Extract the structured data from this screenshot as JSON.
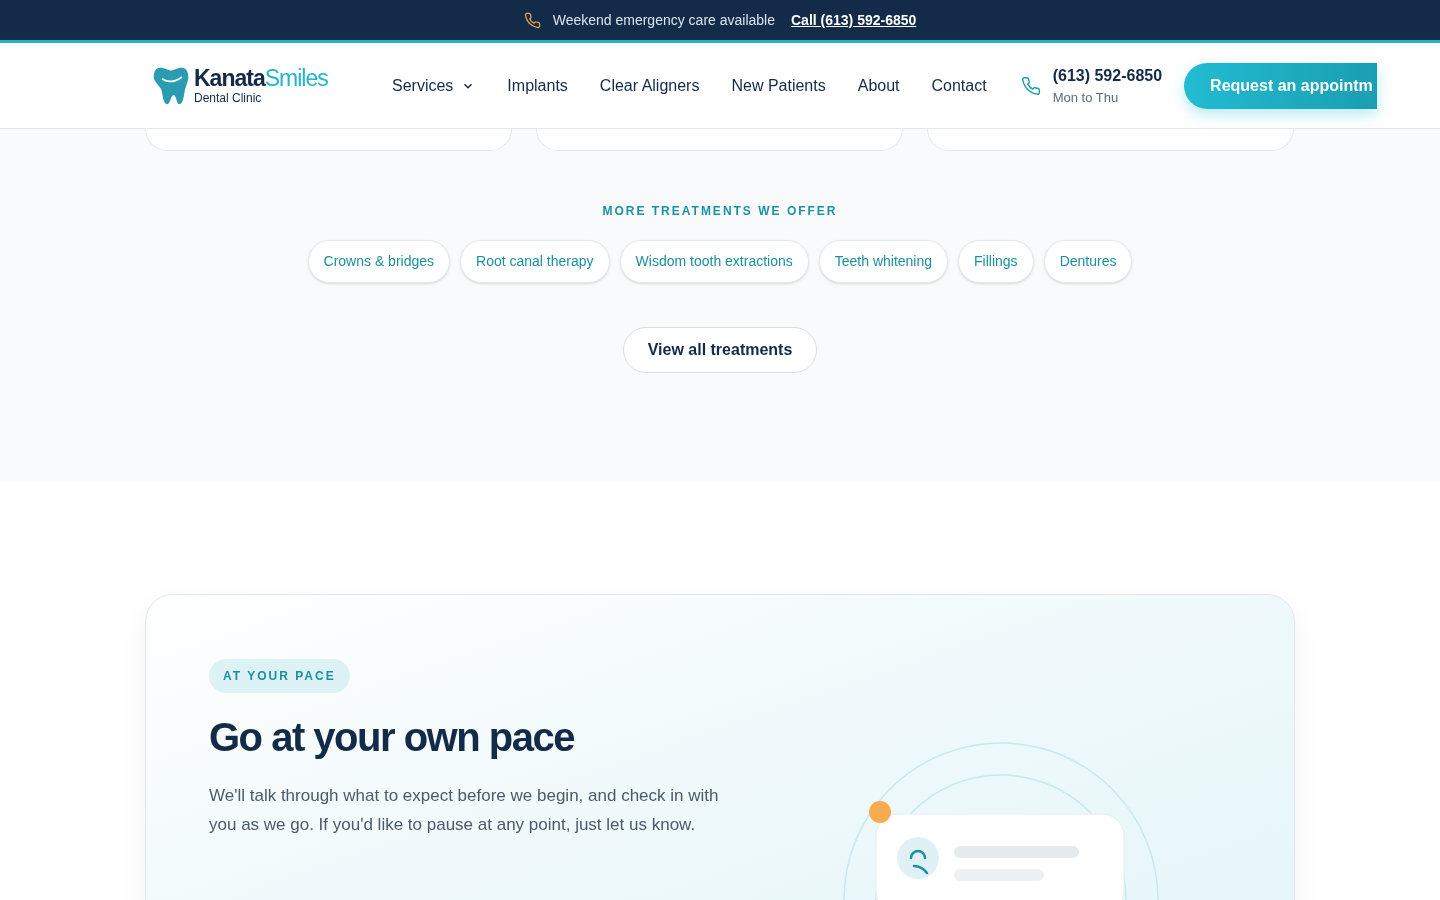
{
  "announcement": {
    "text": "Weekend emergency care available",
    "link": "Call (613) 592-6850"
  },
  "header": {
    "logo": {
      "word_1": "Kanata",
      "word_2": "Smiles",
      "tagline": "Dental Clinic"
    },
    "nav": [
      {
        "label": "Services",
        "dropdown": true
      },
      {
        "label": "Implants",
        "dropdown": false
      },
      {
        "label": "Clear Aligners",
        "dropdown": false
      },
      {
        "label": "New Patients",
        "dropdown": false
      },
      {
        "label": "About",
        "dropdown": false
      },
      {
        "label": "Contact",
        "dropdown": false
      }
    ],
    "phone": {
      "number": "(613) 592-6850",
      "hours": "Mon to Thu"
    },
    "cta": "Request an appointm"
  },
  "treatments": {
    "eyebrow": "MORE TREATMENTS WE OFFER",
    "chips": [
      "Crowns & bridges",
      "Root canal therapy",
      "Wisdom tooth extractions",
      "Teeth whitening",
      "Fillings",
      "Dentures"
    ],
    "button": "View all treatments"
  },
  "pace": {
    "badge": "AT YOUR PACE",
    "title": "Go at your own pace",
    "body": "We'll talk through what to expect before we begin, and check in with you as we go. If you'd like to pause at any point, just let us know."
  }
}
